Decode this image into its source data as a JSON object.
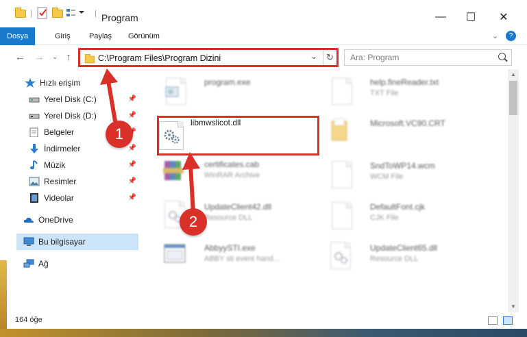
{
  "window": {
    "title": "Program",
    "minimize": "—",
    "maximize": "☐",
    "close": "✕"
  },
  "ribbon": {
    "tabs": [
      {
        "label": "Dosya",
        "active": true
      },
      {
        "label": "Giriş",
        "active": false
      },
      {
        "label": "Paylaş",
        "active": false
      },
      {
        "label": "Görünüm",
        "active": false
      }
    ]
  },
  "address": {
    "path": "C:\\Program Files\\Program Dizini",
    "search_placeholder": "Ara: Program"
  },
  "nav": {
    "items": [
      {
        "label": "Hızlı erişim",
        "icon": "star-icon",
        "pinned": false
      },
      {
        "label": "Yerel Disk (C:)",
        "icon": "drive-icon",
        "pinned": true
      },
      {
        "label": "Yerel Disk (D:)",
        "icon": "drive-icon",
        "pinned": true
      },
      {
        "label": "Belgeler",
        "icon": "documents-icon",
        "pinned": true
      },
      {
        "label": "İndirmeler",
        "icon": "download-icon",
        "pinned": true
      },
      {
        "label": "Müzik",
        "icon": "music-icon",
        "pinned": true
      },
      {
        "label": "Resimler",
        "icon": "pictures-icon",
        "pinned": true
      },
      {
        "label": "Videolar",
        "icon": "video-icon",
        "pinned": true
      },
      {
        "label": "OneDrive",
        "icon": "cloud-icon",
        "pinned": false
      },
      {
        "label": "Bu bilgisayar",
        "icon": "computer-icon",
        "pinned": false,
        "selected": true
      },
      {
        "label": "Ağ",
        "icon": "network-icon",
        "pinned": false
      }
    ]
  },
  "files": {
    "left": [
      {
        "name": "program.exe",
        "type": ""
      },
      {
        "name": "libmwslicot.dll",
        "type": "",
        "highlighted": true
      },
      {
        "name": "certificates.cab",
        "type": "WinRAR Archive"
      },
      {
        "name": "UpdateClient42.dll",
        "type": "Resource DLL"
      },
      {
        "name": "AbbyySTI.exe",
        "type": "ABBY sti event hand..."
      }
    ],
    "right": [
      {
        "name": "help.fineReader.txt",
        "type": "TXT File"
      },
      {
        "name": "Microsoft.VC90.CRT",
        "type": ""
      },
      {
        "name": "SndToWP14.wcm",
        "type": "WCM File"
      },
      {
        "name": "DefaultFont.cjk",
        "type": "CJK File"
      },
      {
        "name": "UpdateClient65.dll",
        "type": "Resource DLL"
      }
    ]
  },
  "status": {
    "count": "164 öğe"
  },
  "annotations": {
    "step1": "1",
    "step2": "2",
    "color": "#d9302a"
  }
}
